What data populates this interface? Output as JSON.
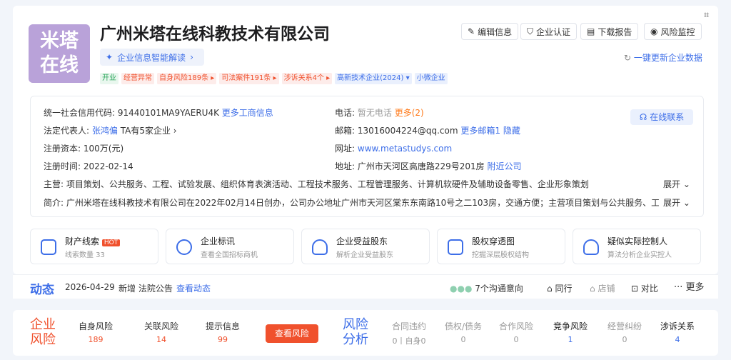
{
  "logo": {
    "line1": "米塔",
    "line2": "在线"
  },
  "company": {
    "name": "广州米塔在线科教技术有限公司"
  },
  "actions": {
    "edit": "编辑信息",
    "cert": "企业认证",
    "download": "下载报告",
    "monitor": "风险监控",
    "update": "一键更新企业数据"
  },
  "ai": {
    "label": "企业信息智能解读"
  },
  "tags": [
    {
      "label": "开业",
      "c": "#2aa55a",
      "bg": "#e9f7ee"
    },
    {
      "label": "经营异常",
      "c": "#f0512d",
      "bg": "#fdecea"
    },
    {
      "label": "自身风险189条 ▸",
      "c": "#f0512d",
      "bg": "#fdecea"
    },
    {
      "label": "司法案件191条 ▸",
      "c": "#f0512d",
      "bg": "#fdecea"
    },
    {
      "label": "涉诉关系4个 ▸",
      "c": "#f0512d",
      "bg": "#fdecea"
    },
    {
      "label": "高新技术企业(2024) ▾",
      "c": "#3d6ee8",
      "bg": "#eaf0fd"
    },
    {
      "label": "小微企业",
      "c": "#3d6ee8",
      "bg": "#eaf0fd"
    }
  ],
  "info": {
    "code_label": "统一社会信用代码:",
    "code": "91440101MA9YAERU4K",
    "more_biz": "更多工商信息",
    "rep_label": "法定代表人:",
    "rep": "张鸿偏",
    "rep_more": "TA有5家企业 ›",
    "cap_label": "注册资本:",
    "cap": "100万(元)",
    "date_label": "注册时间:",
    "date": "2022-02-14",
    "tel_label": "电话:",
    "tel": "暂无电话",
    "tel_more": "更多(2)",
    "mail_label": "邮箱:",
    "mail": "13016004224@qq.com",
    "mail_more": "更多邮箱1",
    "hide": "隐藏",
    "web_label": "网址:",
    "web": "www.metastudys.com",
    "addr_label": "地址:",
    "addr": "广州市天河区高唐路229号201房",
    "nearby": "附近公司",
    "online": "在线联系",
    "scope_label": "主营:",
    "scope": "项目策划、公共服务、工程、试验发展、组织体育表演活动、工程技术服务、工程管理服务、计算机软硬件及辅助设备零售、企业形象策划",
    "intro_label": "简介:",
    "intro": "广州米塔在线科教技术有限公司在2022年02月14日创办，公司办公地址广州市天河区棠东东南路10号之二103房，交通方便；主营项目策划与公共服务、工程",
    "expand": "展开 ⌄"
  },
  "boxes": [
    {
      "t1": "财产线索",
      "hot": "HOT",
      "t2": "线索数量 33"
    },
    {
      "t1": "企业标讯",
      "t2": "查看全国招标商机"
    },
    {
      "t1": "企业受益股东",
      "t2": "解析企业受益股东"
    },
    {
      "t1": "股权穿透图",
      "t2": "挖掘深层股权结构"
    },
    {
      "t1": "疑似实际控制人",
      "t2": "算法分析企业实控人"
    }
  ],
  "dyn": {
    "title": "动态",
    "date": "2026-04-29",
    "text": "新增 法院公告",
    "link": "查看动态",
    "intent": "7个沟通意向",
    "peer": "同行",
    "shop": "店铺",
    "compare": "对比",
    "more": "更多"
  },
  "risk": {
    "t1": "企业",
    "t2": "风险",
    "items": [
      {
        "l": "自身风险",
        "v": "189"
      },
      {
        "l": "关联风险",
        "v": "14"
      },
      {
        "l": "提示信息",
        "v": "99"
      }
    ],
    "btn": "查看风险",
    "a1": "风险",
    "a2": "分析",
    "analysis": [
      {
        "l": "合同违约",
        "v": "0丨自身0"
      },
      {
        "l": "债权/债务",
        "v": "0"
      },
      {
        "l": "合作风险",
        "v": "0"
      },
      {
        "l": "竞争风险",
        "v": "1"
      },
      {
        "l": "经营纠纷",
        "v": "0"
      },
      {
        "l": "涉诉关系",
        "v": "4"
      }
    ]
  }
}
